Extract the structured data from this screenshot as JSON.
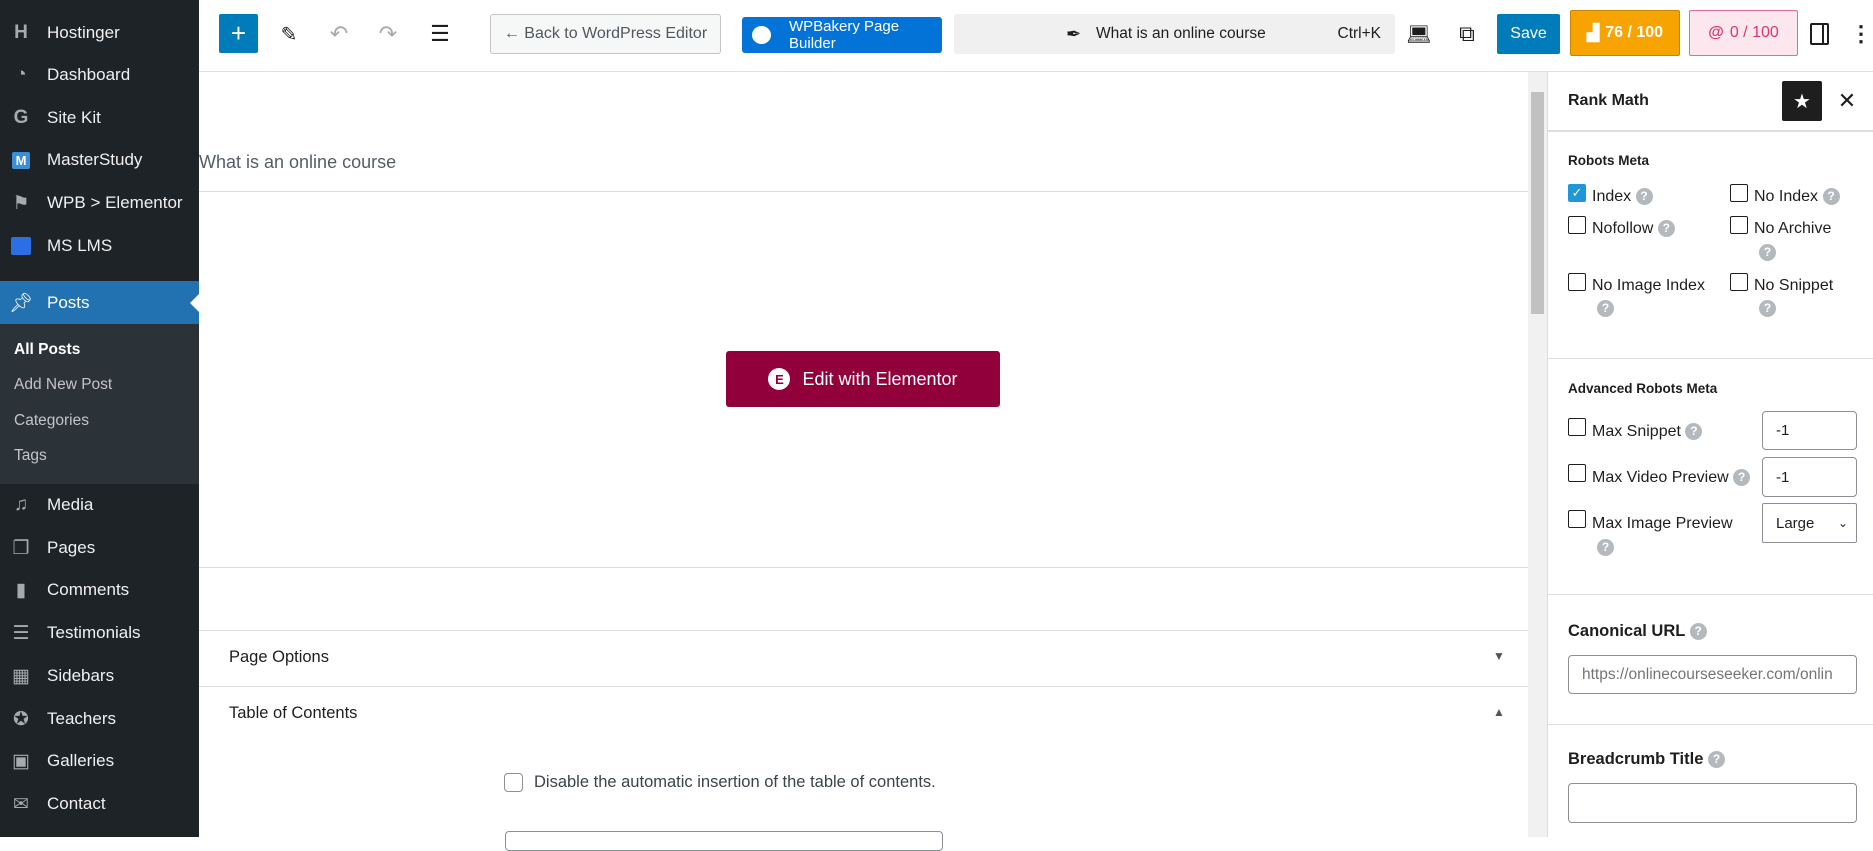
{
  "sidebar": {
    "items": [
      {
        "label": "Hostinger",
        "icon": "hostinger-icon"
      },
      {
        "label": "Dashboard",
        "icon": "dashboard-icon"
      },
      {
        "label": "Site Kit",
        "icon": "google-g-icon"
      },
      {
        "label": "MasterStudy",
        "icon": "masterstudy-icon"
      },
      {
        "label": "WPB > Elementor",
        "icon": "flag-icon"
      },
      {
        "label": "MS LMS",
        "icon": "ms-lms-icon"
      },
      {
        "label": "Posts",
        "icon": "pin-icon"
      },
      {
        "label": "Media",
        "icon": "media-icon"
      },
      {
        "label": "Pages",
        "icon": "pages-icon"
      },
      {
        "label": "Comments",
        "icon": "comment-icon"
      },
      {
        "label": "Testimonials",
        "icon": "testimonial-icon"
      },
      {
        "label": "Sidebars",
        "icon": "sidebars-icon"
      },
      {
        "label": "Teachers",
        "icon": "award-icon"
      },
      {
        "label": "Galleries",
        "icon": "gallery-icon"
      },
      {
        "label": "Contact",
        "icon": "envelope-icon"
      }
    ],
    "submenu": [
      "All Posts",
      "Add New Post",
      "Categories",
      "Tags"
    ]
  },
  "toolbar": {
    "back": "← Back to WordPress Editor",
    "wpbakery": "WPBakery Page Builder",
    "command_title": "What is an online course",
    "shortcut": "Ctrl+K",
    "save": "Save",
    "seo_score": "76 / 100",
    "content_score": "0 / 100",
    "colors": {
      "accent": "#007cba",
      "seo": "#f8a400",
      "content_bg": "#fde7ef",
      "content_fg": "#d63a6a"
    }
  },
  "editor": {
    "post_title": "What is an online course",
    "elementor_button": "Edit with Elementor",
    "elementor_color": "#92003b",
    "page_options": "Page Options",
    "toc": "Table of Contents",
    "toc_disable": "Disable the automatic insertion of the table of contents."
  },
  "panel": {
    "title": "Rank Math",
    "robots_meta": "Robots Meta",
    "robots": [
      {
        "label": "Index",
        "checked": true
      },
      {
        "label": "No Index",
        "checked": false
      },
      {
        "label": "Nofollow",
        "checked": false
      },
      {
        "label": "No Archive",
        "checked": false
      },
      {
        "label": "No Image Index",
        "checked": false
      },
      {
        "label": "No Snippet",
        "checked": false
      }
    ],
    "advanced": "Advanced Robots Meta",
    "max_snippet": "Max Snippet",
    "max_snippet_value": "-1",
    "max_video": "Max Video Preview",
    "max_video_value": "-1",
    "max_image": "Max Image Preview",
    "max_image_value": "Large",
    "canonical": "Canonical URL",
    "canonical_placeholder": "https://onlinecourseseeker.com/onlin",
    "breadcrumb": "Breadcrumb Title",
    "breadcrumb_value": ""
  }
}
